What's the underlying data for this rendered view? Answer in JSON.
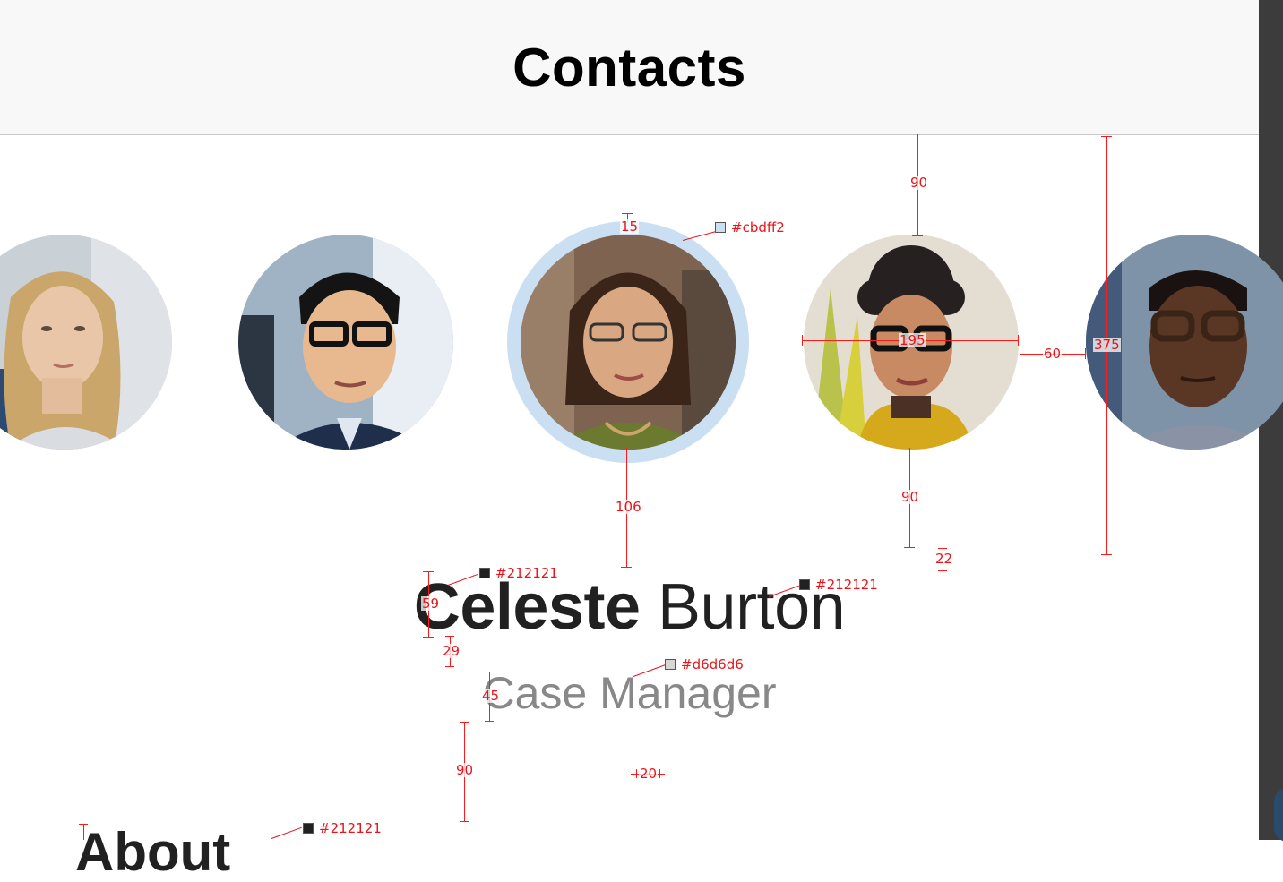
{
  "header": {
    "title": "Contacts"
  },
  "contact": {
    "first_name": "Celeste",
    "last_name": "Burton",
    "role": "Case Manager",
    "about_heading_peek": "About"
  },
  "carousel": {
    "avatars": [
      {
        "name": "avatar-woman-blonde",
        "skin": "#e9c6a8",
        "hair": "#caa66a",
        "bg": "#c9d0d6",
        "shirt": "#d9dde2"
      },
      {
        "name": "avatar-man-glasses",
        "skin": "#e8b98f",
        "hair": "#141414",
        "bg": "#9fb3c4",
        "shirt": "#1f2e4a"
      },
      {
        "name": "avatar-celeste-burton",
        "skin": "#d9a782",
        "hair": "#3b2418",
        "bg": "#7e6450",
        "shirt": "#6b7a2e"
      },
      {
        "name": "avatar-woman-curly",
        "skin": "#c78a63",
        "hair": "#262020",
        "bg": "#e3ddd2",
        "shirt": "#d6a91c"
      },
      {
        "name": "avatar-man-glasses-2",
        "skin": "#5a3624",
        "hair": "#1a1210",
        "bg": "#7f93a8",
        "shirt": "#8a92a6"
      }
    ]
  },
  "redlines": {
    "colors": {
      "ring": "#cbdff2",
      "text_primary": "#212121",
      "text_secondary": "#d6d6d6"
    },
    "labels": {
      "ring_gap": "15",
      "ring_color": "#cbdff2",
      "top_gap": "90",
      "avatar_width": "195",
      "avatar_spacing": "60",
      "carousel_height": "375",
      "avatar_to_name": "106",
      "avatar_bottom_gap": "90",
      "small_gap": "22",
      "name_color_a": "#212121",
      "name_color_b": "#212121",
      "name_height": "59",
      "name_to_role": "29",
      "role_color": "#d6d6d6",
      "role_height": "45",
      "role_to_about": "90",
      "center_gap": "20",
      "about_color": "#212121"
    }
  }
}
